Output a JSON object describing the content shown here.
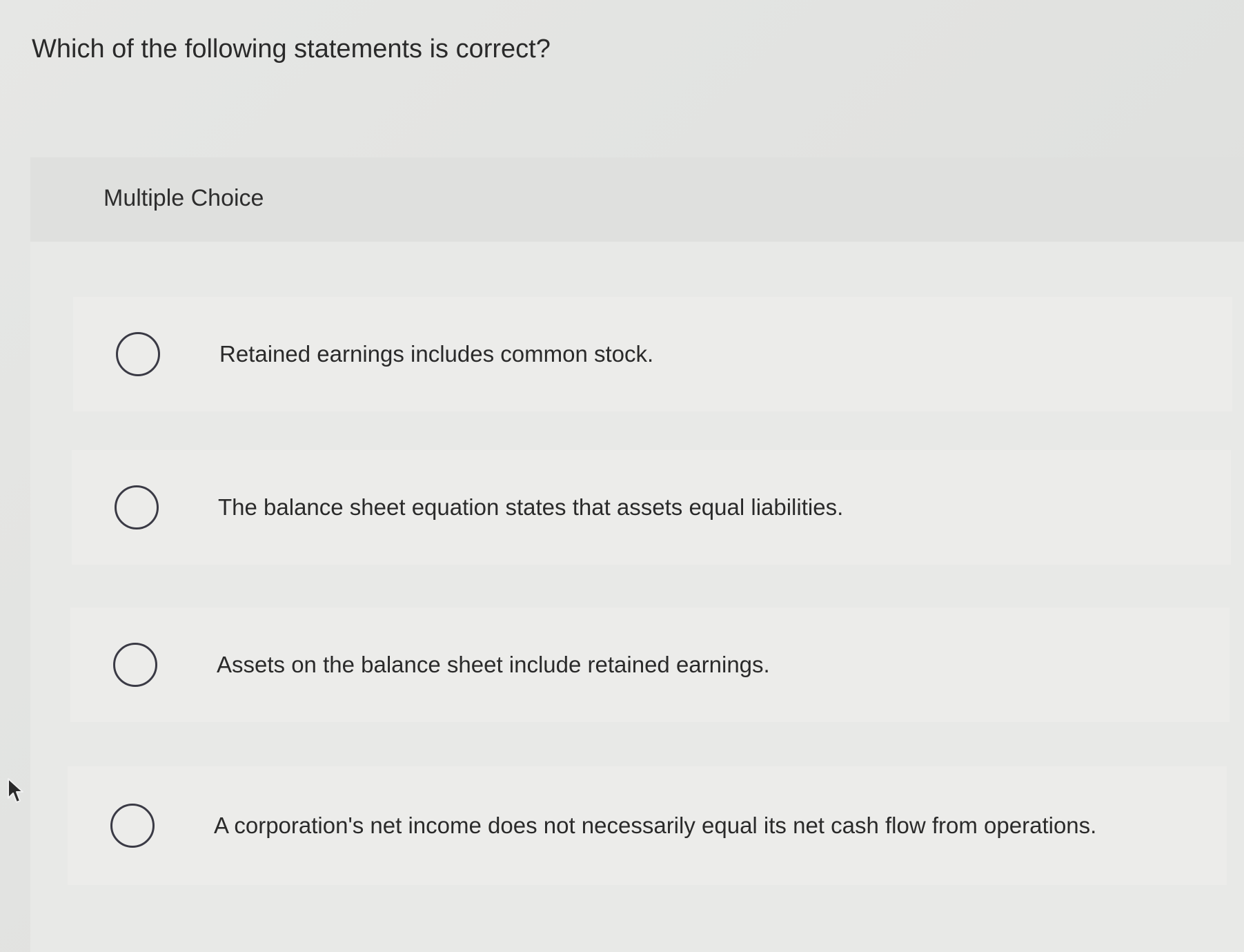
{
  "question": {
    "text": "Which of the following statements is correct?"
  },
  "card": {
    "type_label": "Multiple Choice"
  },
  "options": [
    {
      "label": "Retained earnings includes common stock.",
      "selected": false
    },
    {
      "label": "The balance sheet equation states that assets equal liabilities.",
      "selected": false
    },
    {
      "label": "Assets on the balance sheet include retained earnings.",
      "selected": false
    },
    {
      "label": "A corporation's net income does not necessarily equal its net cash flow from operations.",
      "selected": false
    }
  ],
  "icons": {
    "cursor": "pointer-arrow-icon",
    "radio": "radio-unchecked-icon"
  },
  "colors": {
    "background": "#e3e4e2",
    "card": "#e8e9e7",
    "card_header": "#dfe0de",
    "option_bg": "#ececea",
    "radio_border": "#3a3a45",
    "text": "#2a2a2a"
  }
}
